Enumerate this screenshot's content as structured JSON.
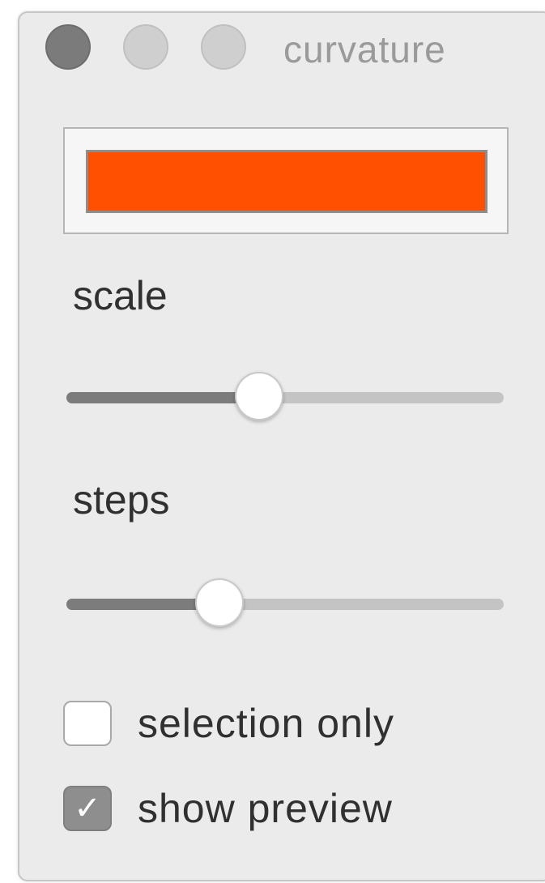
{
  "window": {
    "title": "curvature"
  },
  "color_well": {
    "color": "#ff4f00"
  },
  "sliders": [
    {
      "label": "scale",
      "value_fraction": 0.44
    },
    {
      "label": "steps",
      "value_fraction": 0.35
    }
  ],
  "checkboxes": [
    {
      "label": "selection only",
      "checked": false
    },
    {
      "label": "show preview",
      "checked": true
    }
  ],
  "icons": {
    "close": "close-button-icon",
    "minimize": "minimize-button-icon",
    "zoom": "zoom-button-icon",
    "check": "check-mark-icon"
  }
}
